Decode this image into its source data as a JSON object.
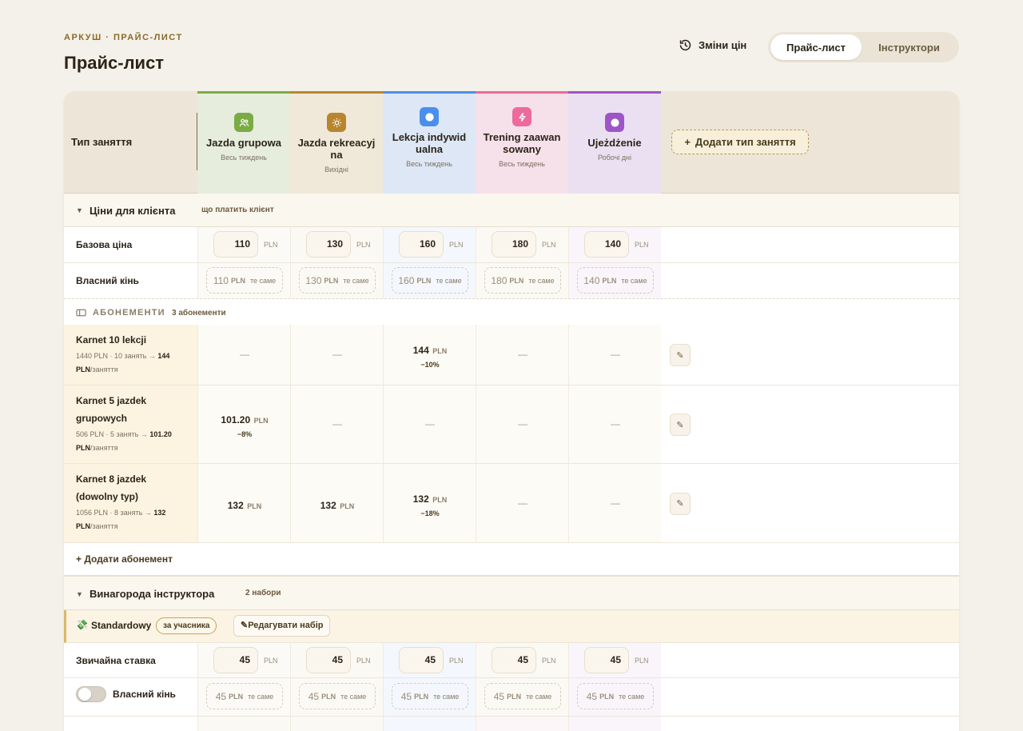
{
  "eyebrow": "АРКУШ · ПРАЙС-ЛИСТ",
  "title": "Прайс-лист",
  "history_label": "Зміни цін",
  "tabs": {
    "price": "Прайс-лист",
    "instructors": "Інструктори"
  },
  "header": {
    "type_label": "Тип заняття",
    "add_type": "Додати тип заняття"
  },
  "columns": [
    {
      "name": "Jazda grupowa",
      "sub": "Весь тиждень",
      "color": "#7bab45",
      "bg": "#e7eddd",
      "icon": "people-icon"
    },
    {
      "name": "Jazda rekreacyjna",
      "sub": "Вихідні",
      "color": "#b8862f",
      "bg": "#f0e8d9",
      "icon": "sun-icon"
    },
    {
      "name": "Lekcja indywidualna",
      "sub": "Весь тиждень",
      "color": "#4b8fec",
      "bg": "#dde7f6",
      "icon": "circle-icon"
    },
    {
      "name": "Trening zaawansowany",
      "sub": "Весь тиждень",
      "color": "#ec6a9c",
      "bg": "#f6e0ea",
      "icon": "bolt-icon"
    },
    {
      "name": "Ujeżdżenie",
      "sub": "Робочі дні",
      "color": "#9d55c7",
      "bg": "#ebe0f1",
      "icon": "circle-icon"
    }
  ],
  "client": {
    "title": "Ціни для клієнта",
    "note": "що платить клієнт",
    "base_label": "Базова ціна",
    "base": [
      "110",
      "130",
      "160",
      "180",
      "140"
    ],
    "own_label": "Власний кінь",
    "own": [
      "110",
      "130",
      "160",
      "180",
      "140"
    ],
    "unit": "PLN",
    "same": "те саме"
  },
  "subs": {
    "title": "АБОНЕМЕНТИ",
    "count": "3 абонементи",
    "add": "Додати абонемент",
    "items": [
      {
        "name1": "Karnet 10 lekcji",
        "name2": "",
        "det_a": "1440 PLN · 10 занять →",
        "det_b": "144",
        "det_c": "PLN",
        "det_d": "/заняття",
        "cells": [
          null,
          null,
          {
            "v": "144",
            "pct": "−10%"
          },
          null,
          null
        ]
      },
      {
        "name1": "Karnet 5 jazdek",
        "name2": "grupowych",
        "det_a": "506 PLN · 5 занять →",
        "det_b": "101.20",
        "det_c": "PLN",
        "det_d": "/заняття",
        "cells": [
          {
            "v": "101.20",
            "pct": "−8%"
          },
          null,
          null,
          null,
          null
        ]
      },
      {
        "name1": "Karnet 8 jazdek",
        "name2": "(dowolny typ)",
        "det_a": "1056 PLN · 8 занять →",
        "det_b": "132",
        "det_c": "PLN",
        "det_d": "/заняття",
        "cells": [
          {
            "v": "132",
            "pct": ""
          },
          {
            "v": "132",
            "pct": ""
          },
          {
            "v": "132",
            "pct": "−18%"
          },
          null,
          null
        ]
      }
    ]
  },
  "instructor": {
    "title": "Винагорода інструктора",
    "count": "2 набори",
    "set_name": "Standardowy",
    "set_badge": "за учасника",
    "set_edit": "Редагувати набір",
    "rate_label": "Звичайна ставка",
    "rate": [
      "45",
      "45",
      "45",
      "45",
      "45"
    ],
    "own_label": "Власний кінь",
    "own": [
      "45",
      "45",
      "45",
      "45",
      "45"
    ]
  }
}
